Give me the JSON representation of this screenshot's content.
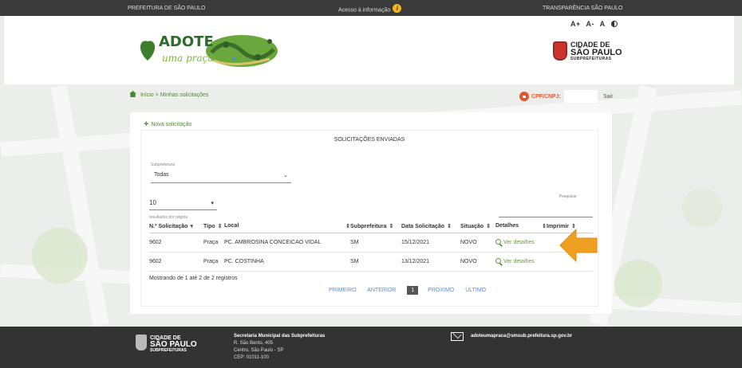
{
  "topbar": {
    "left": "PREFEITURA DE SÃO PAULO",
    "center": "Acesso à informação",
    "right": "TRANSPARÊNCIA SÃO PAULO"
  },
  "header": {
    "font_controls": [
      "A+",
      "A-",
      "A"
    ],
    "logo": {
      "title": "ADOTE",
      "subtitle": "uma praça"
    },
    "city_logo": {
      "line1": "CIDADE DE",
      "line2": "SÃO PAULO",
      "line3": "SUBPREFEITURAS"
    }
  },
  "breadcrumb": {
    "home": "Início",
    "separator": ">",
    "current": "Minhas solicitações"
  },
  "user": {
    "cpf_label": "CPF/CNPJ:",
    "logout": "Sair"
  },
  "card": {
    "new_request": "Nova solicitação",
    "title": "SOLICITAÇÕES ENVIADAS",
    "filter": {
      "label": "Subprefeitura",
      "value": "Todas"
    },
    "page_size": {
      "value": "10",
      "label": "resultados por página"
    },
    "search_label": "Pesquisar",
    "columns": [
      "N.º Solicitação",
      "Tipo",
      "Local",
      "Subprefeitura",
      "Data Solicitação",
      "Situação",
      "Detalhes",
      "Imprimir"
    ],
    "rows": [
      {
        "num": "9602",
        "tipo": "Praça",
        "local": "PC. AMBROSINA CONCEICAO VIDAL",
        "subpref": "SM",
        "data": "15/12/2021",
        "situacao": "NOVO",
        "detalhes": "Ver detalhes"
      },
      {
        "num": "9602",
        "tipo": "Praça",
        "local": "PC. COSTINHA",
        "subpref": "SM",
        "data": "13/12/2021",
        "situacao": "NOVO",
        "detalhes": "Ver detalhes"
      }
    ],
    "summary": "Mostrando de 1 até 2 de 2 registros",
    "pager": {
      "first": "PRIMEIRO",
      "prev": "ANTERIOR",
      "current": "1",
      "next": "PRÓXIMO",
      "last": "ÚLTIMO"
    }
  },
  "footer": {
    "logo": {
      "line1": "CIDADE DE",
      "line2": "SÃO PAULO",
      "line3": "SUBPREFEITURAS"
    },
    "address": {
      "title": "Secretaria Municipal das Subprefeituras",
      "line1": "R. São Bento, 405",
      "line2": "Centro, São Paulo - SP",
      "line3": "CEP: 01011-100"
    },
    "email": "adoteumapraca@smsub.prefeitura.sp.gov.br"
  },
  "colors": {
    "accent_green": "#4a8a2c",
    "cpf_orange": "#e8542b",
    "arrow_orange": "#f0a020",
    "pager_blue": "#5b8ec9"
  }
}
